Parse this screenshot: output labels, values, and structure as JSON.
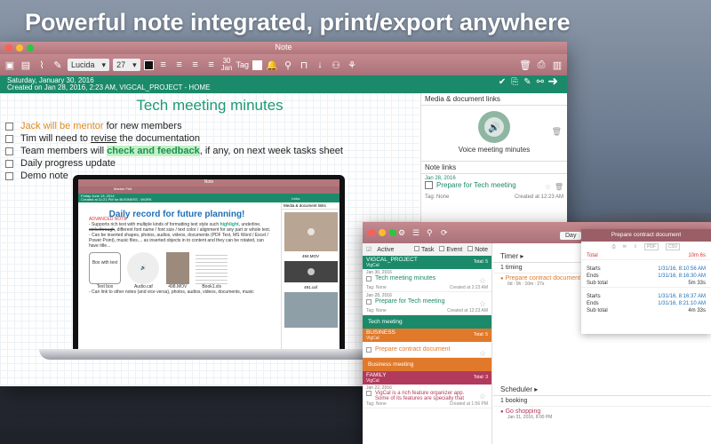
{
  "headline": "Powerful note integrated, print/export anywhere",
  "note_window": {
    "title": "Note",
    "font_name": "Lucida",
    "font_size": "27",
    "date_day": "30",
    "date_month": "Jan",
    "tag_label": "Tag",
    "header_date": "Saturday, January 30, 2016",
    "header_created": "Created on Jan 28, 2016, 2:23 AM, VIGCAL_PROJECT - HOME",
    "doc_title": "Tech meeting minutes",
    "line1_orange": "Jack will be mentor",
    "line1_rest": " for new members",
    "line2_a": "Tim will need to ",
    "line2_u": "revise",
    "line2_b": " the documentation",
    "line3_a": "Team members will ",
    "line3_hl": "check and feedback",
    "line3_b": ", if any, on next week tasks sheet",
    "line4": "Daily progress update",
    "line5": "Demo note",
    "media_heading": "Media & document links",
    "voice_label": "Voice meeting minutes",
    "note_links_heading": "Note links",
    "link_date": "Jan 28, 2016",
    "link_title": "Prepare for Tech meeting",
    "link_tag": "Tag: None",
    "link_created": "Created at 12:23 AM"
  },
  "laptop": {
    "mini_title_bar": "Note",
    "mini_date": "Friday June 13, 2014",
    "mini_created": "Created at 11:21 PM for BUSINESS - WORK",
    "mini_font": "Marker Felt",
    "mini_links": "Links",
    "mini_media": "Media & document links",
    "title": "Daily record for future planning!",
    "advanced": "ADVANCED NOTE",
    "p1_a": "- Supports rich text with multiple kinds of formatting text style such ",
    "p1_hl": "highlight",
    "p1_b": ", underline, ",
    "p1_strike": "strikethrough",
    "p1_c": ", different font name / font size / text color / alignment for any part or whole text.",
    "p2": "- Can be inserted shapes, photos, audios, videos, documents (PDF Text, MS Word / Excel / Power Point), music files.... as inserted objects in to content and they can be rotated, can have title...",
    "p3": "- Can link to other notes (and vice versa), photos, audios, videos, documents, music",
    "att1_label": "Text box",
    "att1_inner": "Box with text",
    "att2_label": "Audio.caf",
    "att3_label": "498.MOV",
    "att4_label": "Book1.xls",
    "side1": "494.MOV",
    "side2": "491.caf"
  },
  "calendar": {
    "day_btn": "Day",
    "filter_active": "Active",
    "filter_task": "Task",
    "filter_event": "Event",
    "filter_note": "Note",
    "grp1_name": "VIGCAL_PROJECT",
    "grp1_sub": "VigCal",
    "grp1_total": "Total: 5",
    "i1_date": "Jan 30, 2016",
    "i1_title": "Tech meeting minutes",
    "i1_tag": "Tag: None",
    "i1_created": "Created at 2:23 AM",
    "i2_date": "Jan 28, 2016",
    "i2_title": "Prepare for Tech meeting",
    "i2_tag": "Tag: None",
    "i2_created": "Created at 12:23 AM",
    "bar1": "Tech meeting",
    "grp2_name": "BUSINESS",
    "grp2_sub": "VigCal",
    "grp2_total": "Total: 5",
    "i3_title": "Prepare contract document",
    "bar2": "Business meeting",
    "grp3_name": "FAMILY",
    "grp3_sub": "VigCal",
    "grp3_total": "Total: 3",
    "i4_date": "Jan 22, 2016",
    "i4_title_a": "VigCal is a rich feature organizer app.",
    "i4_title_b": "Some of its features are specially that",
    "i4_tag": "Tag: None",
    "i4_created": "Created at 1:56 PM",
    "timer_heading": "Timer",
    "timer_count": "1 timing",
    "timer_item": "Prepare contract document",
    "timer_item_sub": "0d : 0h : 10m : 27s",
    "scheduler_heading": "Scheduler",
    "booking_count": "1 booking",
    "booking_item": "Go shopping",
    "booking_sub": "Jan 31, 2016, 8:00 PM",
    "pop_title": "Prepare contract document",
    "pop_pdf": "PDF",
    "pop_csv": "CSV",
    "total_label": "Total",
    "total_val": "10m 6s",
    "starts_label": "Starts",
    "ends_label": "Ends",
    "subtotal_label": "Sub total",
    "s1_start": "1/31/16, 8:10:56 AM",
    "s1_end": "1/31/16, 8:16:30 AM",
    "s1_sub": "5m 33s",
    "s2_start": "1/31/16, 8:16:37 AM",
    "s2_end": "1/31/16, 8:21:10 AM",
    "s2_sub": "4m 33s"
  },
  "colors": {
    "accent": "#1b8a6a",
    "titlebar": "#b1767b",
    "orange": "#e0792a"
  }
}
